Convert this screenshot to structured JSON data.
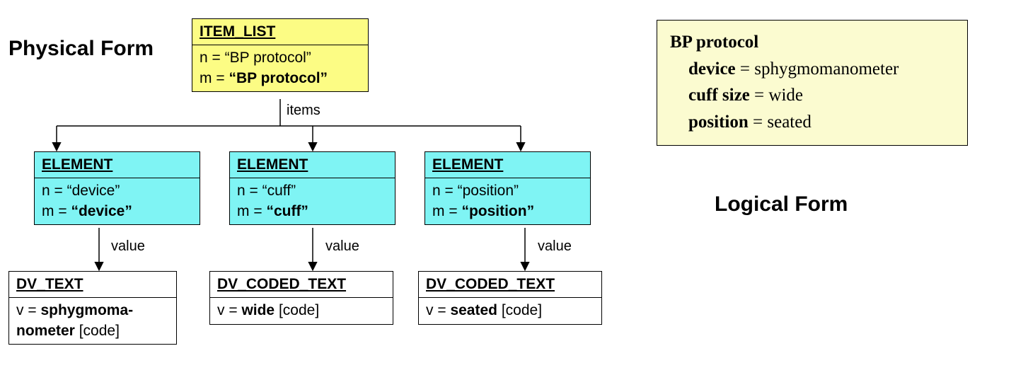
{
  "headings": {
    "physical": "Physical Form",
    "logical": "Logical Form"
  },
  "root": {
    "type": "ITEM_LIST",
    "n": "“BP protocol”",
    "m": "“BP protocol”",
    "items_label": "items"
  },
  "elements": [
    {
      "type": "ELEMENT",
      "n": "“device”",
      "m": "“device”",
      "value_label": "value",
      "dv_type": "DV_TEXT",
      "v_bold": "sphygmoma-\nnometer",
      "v_tail": " [code]"
    },
    {
      "type": "ELEMENT",
      "n": "“cuff”",
      "m": "“cuff”",
      "value_label": "value",
      "dv_type": "DV_CODED_TEXT",
      "v_bold": "wide",
      "v_tail": " [code]"
    },
    {
      "type": "ELEMENT",
      "n": "“position”",
      "m": "“position”",
      "value_label": "value",
      "dv_type": "DV_CODED_TEXT",
      "v_bold": "seated",
      "v_tail": " [code]"
    }
  ],
  "logical": {
    "title": "BP protocol",
    "rows": [
      {
        "label": "device",
        "value": "sphygmomanometer"
      },
      {
        "label": "cuff size",
        "value": "wide"
      },
      {
        "label": "position",
        "value": "seated"
      }
    ]
  }
}
